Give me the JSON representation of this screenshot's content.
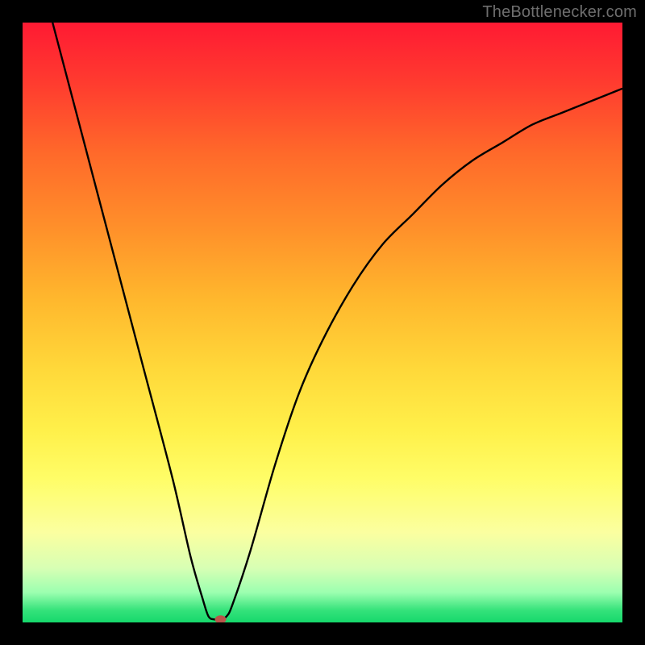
{
  "watermark": "TheBottlenecker.com",
  "colors": {
    "frame": "#000000",
    "curve": "#000000",
    "marker": "#b9564a"
  },
  "chart_data": {
    "type": "line",
    "title": "",
    "xlabel": "",
    "ylabel": "",
    "xlim": [
      0,
      100
    ],
    "ylim": [
      0,
      100
    ],
    "grid": false,
    "legend": false,
    "series": [
      {
        "name": "bottleneck-curve",
        "x": [
          5,
          10,
          15,
          20,
          25,
          28,
          30,
          31,
          32,
          33,
          34,
          35,
          38,
          42,
          46,
          50,
          55,
          60,
          65,
          70,
          75,
          80,
          85,
          90,
          95,
          100
        ],
        "values": [
          100,
          81,
          62,
          43,
          24,
          11,
          4,
          1,
          0.5,
          0.5,
          1,
          3,
          12,
          26,
          38,
          47,
          56,
          63,
          68,
          73,
          77,
          80,
          83,
          85,
          87,
          89
        ]
      }
    ],
    "marker": {
      "x": 33,
      "y": 0.5
    },
    "background_gradient": "red-yellow-green-vertical"
  }
}
